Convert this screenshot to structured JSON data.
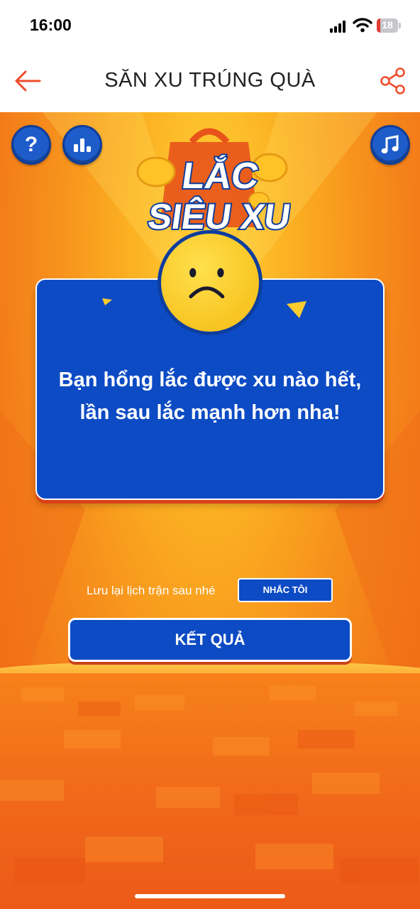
{
  "status_bar": {
    "time": "16:00",
    "battery": "18",
    "battery_level": 0.18
  },
  "nav": {
    "title": "SĂN XU TRÚNG QUÀ",
    "back_icon": "arrow-left-icon",
    "share_icon": "share-icon"
  },
  "game": {
    "logo": {
      "line1": "LẮC",
      "line2": "SIÊU XU"
    },
    "buttons": {
      "help": "?",
      "rank_icon": "bar-chart-icon",
      "music_icon": "music-note-icon"
    },
    "result_card": {
      "line1": "Bạn hổng lắc được xu nào hết,",
      "line2": "lần sau lắc mạnh hơn nha!"
    },
    "reminder": {
      "text": "Lưu lại lịch trận sau nhé",
      "button": "NHẮC TÔI"
    },
    "result_button": "KẾT QUẢ"
  },
  "colors": {
    "accent": "#ee4d2d",
    "card_blue": "#0d4bc4",
    "background_orange": "#f47a16"
  }
}
